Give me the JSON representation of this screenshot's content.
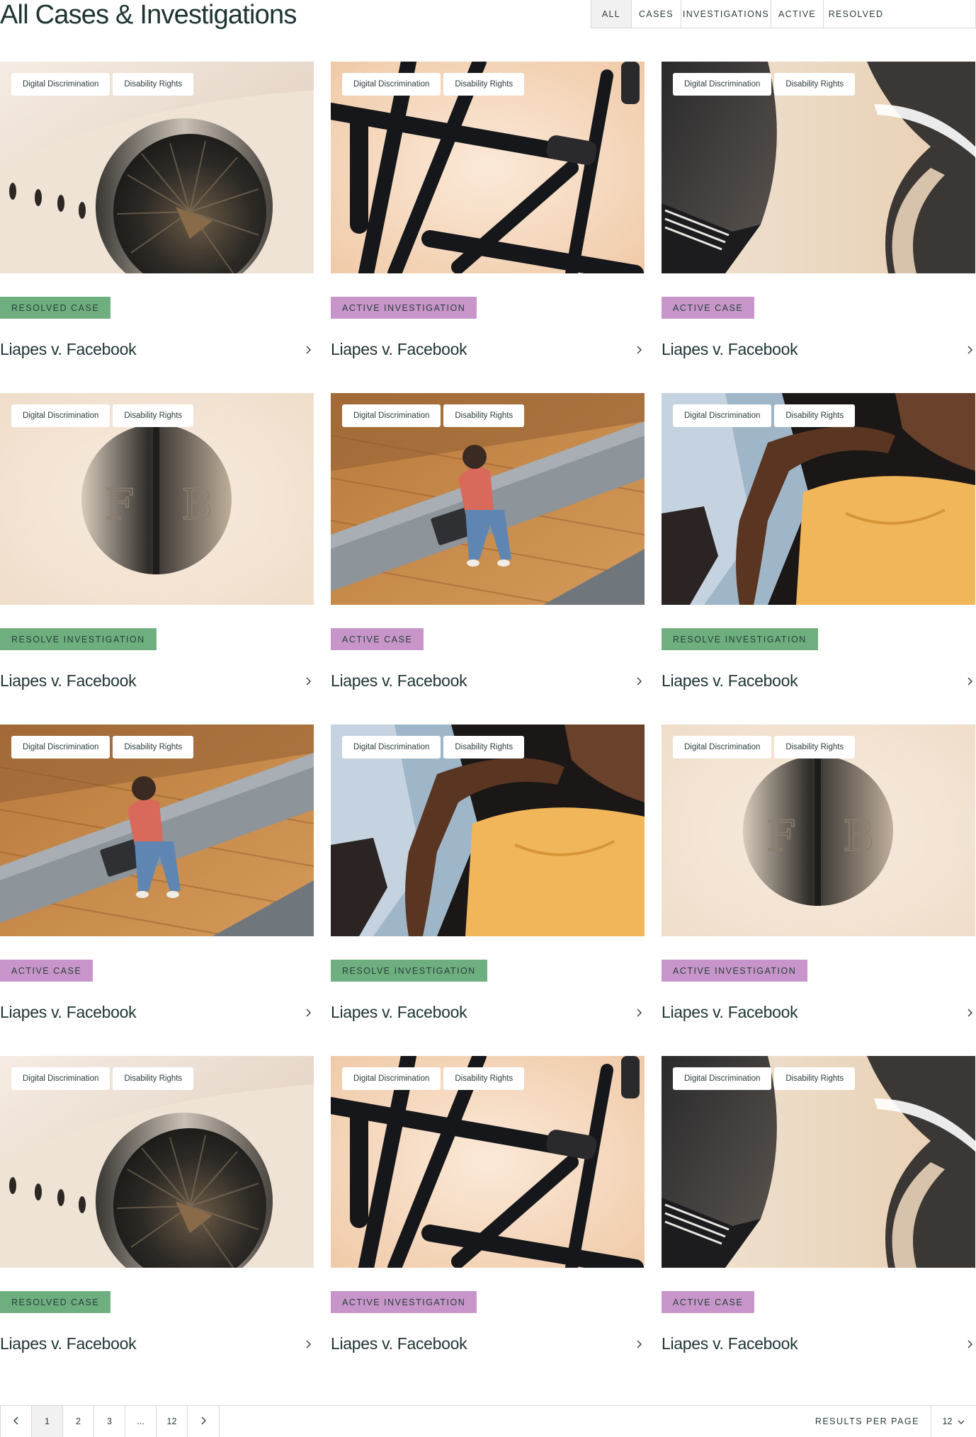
{
  "page": {
    "title": "All Cases & Investigations"
  },
  "filters": [
    "ALL",
    "CASES",
    "INVESTIGATIONS",
    "ACTIVE",
    "RESOLVED"
  ],
  "active_filter": "ALL",
  "colors": {
    "resolved": "#6fae7f",
    "active": "#c795c9",
    "text": "#1f3333",
    "border": "#d9d9d9"
  },
  "cards": [
    {
      "tags": [
        "Digital Discrimination",
        "Disability Rights"
      ],
      "status": "RESOLVED CASE",
      "status_type": "resolved",
      "title": "Liapes v. Facebook",
      "image": "jet-engine"
    },
    {
      "tags": [
        "Digital Discrimination",
        "Disability Rights"
      ],
      "status": "ACTIVE INVESTIGATION",
      "status_type": "active",
      "title": "Liapes v. Facebook",
      "image": "toothbrushes"
    },
    {
      "tags": [
        "Digital Discrimination",
        "Disability Rights"
      ],
      "status": "ACTIVE CASE",
      "status_type": "active",
      "title": "Liapes v. Facebook",
      "image": "car-front"
    },
    {
      "tags": [
        "Digital Discrimination",
        "Disability Rights"
      ],
      "status": "RESOLVE INVESTIGATION",
      "status_type": "resolved",
      "title": "Liapes v. Facebook",
      "image": "fb-coin"
    },
    {
      "tags": [
        "Digital Discrimination",
        "Disability Rights"
      ],
      "status": "ACTIVE CASE",
      "status_type": "active",
      "title": "Liapes v. Facebook",
      "image": "woman-laptop"
    },
    {
      "tags": [
        "Digital Discrimination",
        "Disability Rights"
      ],
      "status": "RESOLVE INVESTIGATION",
      "status_type": "resolved",
      "title": "Liapes v. Facebook",
      "image": "arm-shoulder"
    },
    {
      "tags": [
        "Digital Discrimination",
        "Disability Rights"
      ],
      "status": "ACTIVE CASE",
      "status_type": "active",
      "title": "Liapes v. Facebook",
      "image": "woman-laptop"
    },
    {
      "tags": [
        "Digital Discrimination",
        "Disability Rights"
      ],
      "status": "RESOLVE INVESTIGATION",
      "status_type": "resolved",
      "title": "Liapes v. Facebook",
      "image": "arm-shoulder"
    },
    {
      "tags": [
        "Digital Discrimination",
        "Disability Rights"
      ],
      "status": "ACTIVE INVESTIGATION",
      "status_type": "active",
      "title": "Liapes v. Facebook",
      "image": "fb-coin"
    },
    {
      "tags": [
        "Digital Discrimination",
        "Disability Rights"
      ],
      "status": "RESOLVED CASE",
      "status_type": "resolved",
      "title": "Liapes v. Facebook",
      "image": "jet-engine"
    },
    {
      "tags": [
        "Digital Discrimination",
        "Disability Rights"
      ],
      "status": "ACTIVE INVESTIGATION",
      "status_type": "active",
      "title": "Liapes v. Facebook",
      "image": "toothbrushes"
    },
    {
      "tags": [
        "Digital Discrimination",
        "Disability Rights"
      ],
      "status": "ACTIVE CASE",
      "status_type": "active",
      "title": "Liapes v. Facebook",
      "image": "car-front"
    }
  ],
  "pagination": {
    "pages": [
      "1",
      "2",
      "3",
      "...",
      "12"
    ],
    "current_page": "1",
    "results_per_page_label": "RESULTS PER PAGE",
    "results_per_page_value": "12"
  }
}
